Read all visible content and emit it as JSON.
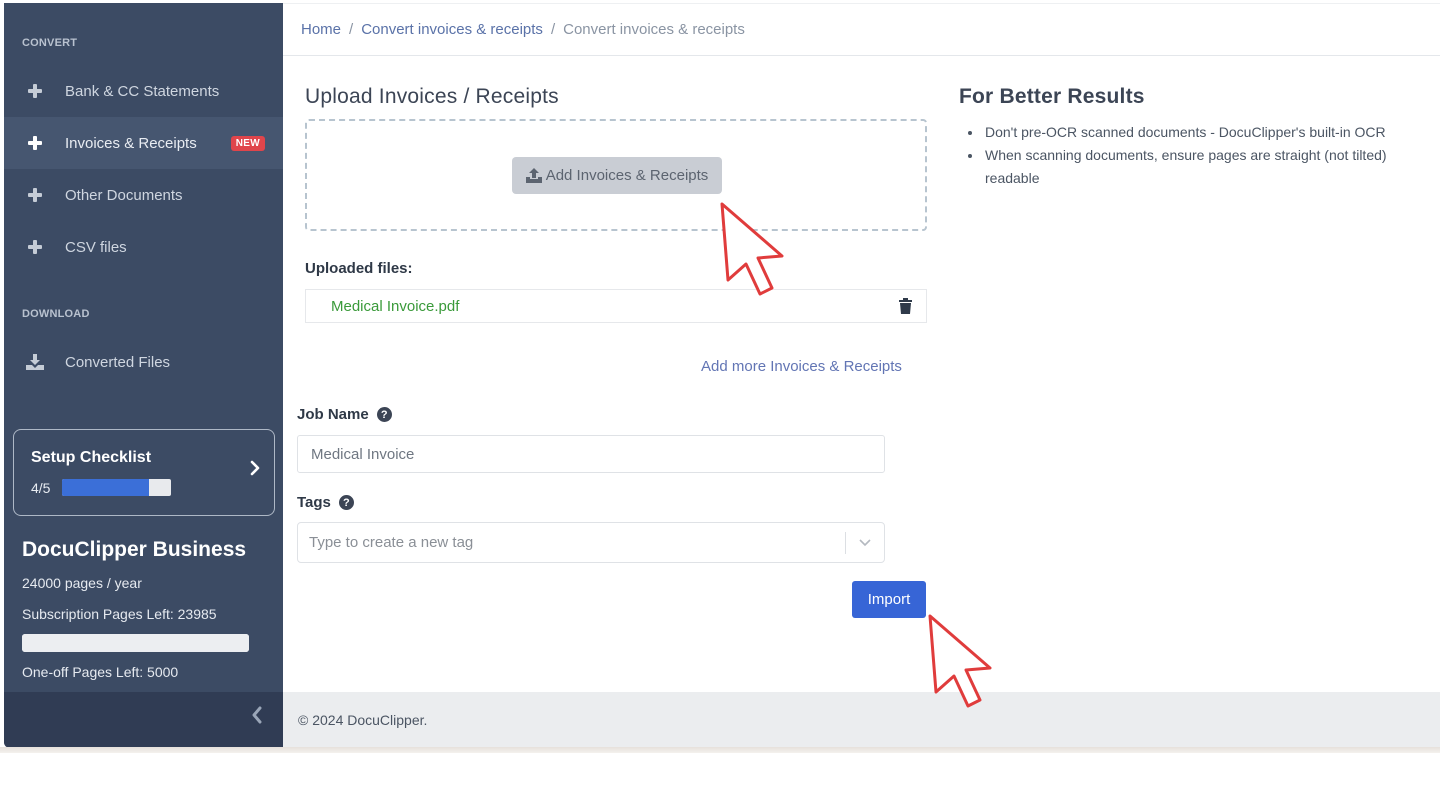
{
  "sidebar": {
    "convert_section": "CONVERT",
    "convert_items": [
      {
        "label": "Bank & CC Statements",
        "icon": "plus-icon",
        "active": false
      },
      {
        "label": "Invoices & Receipts",
        "icon": "plus-icon",
        "active": true,
        "badge": "NEW"
      },
      {
        "label": "Other Documents",
        "icon": "plus-icon",
        "active": false
      },
      {
        "label": "CSV files",
        "icon": "plus-icon",
        "active": false
      }
    ],
    "download_section": "DOWNLOAD",
    "download_items": [
      {
        "label": "Converted Files",
        "icon": "download-icon"
      }
    ],
    "checklist": {
      "title": "Setup Checklist",
      "progress_text": "4/5",
      "completed": 4,
      "total": 5,
      "progress_color": "#3b6fd8"
    },
    "plan": {
      "name": "DocuClipper Business",
      "pages_per_year": "24000 pages / year",
      "subscription_left": "Subscription Pages Left: 23985",
      "subscription_remaining_fraction": 0.9994,
      "oneoff_left": "One-off Pages Left: 5000"
    },
    "collapse_icon": "chevron-left-icon"
  },
  "breadcrumb": [
    {
      "label": "Home",
      "link": true
    },
    {
      "label": "Convert invoices & receipts",
      "link": true
    },
    {
      "label": "Convert invoices & receipts",
      "link": false
    }
  ],
  "breadcrumb_separator": "/",
  "upload": {
    "title": "Upload Invoices / Receipts",
    "add_button": "Add Invoices & Receipts",
    "uploaded_label": "Uploaded files:",
    "files": [
      {
        "name": "Medical Invoice.pdf"
      }
    ],
    "add_more": "Add more Invoices & Receipts"
  },
  "form": {
    "job_name_label": "Job Name",
    "job_name_value": "Medical Invoice",
    "tags_label": "Tags",
    "tags_placeholder": "Type to create a new tag",
    "help_glyph": "?",
    "import_button": "Import"
  },
  "tips": {
    "title": "For Better Results",
    "items": [
      "Don't pre-OCR scanned documents - DocuClipper's built-in OCR",
      "When scanning documents, ensure pages are straight (not tilted)",
      "readable"
    ]
  },
  "footer": {
    "copyright": "© 2024 DocuClipper."
  },
  "colors": {
    "sidebar_bg": "#3c4b64",
    "accent_blue": "#3765d6",
    "badge_red": "#e0454b",
    "file_green": "#3a9a3a",
    "annotation_red": "#e03c3c"
  }
}
